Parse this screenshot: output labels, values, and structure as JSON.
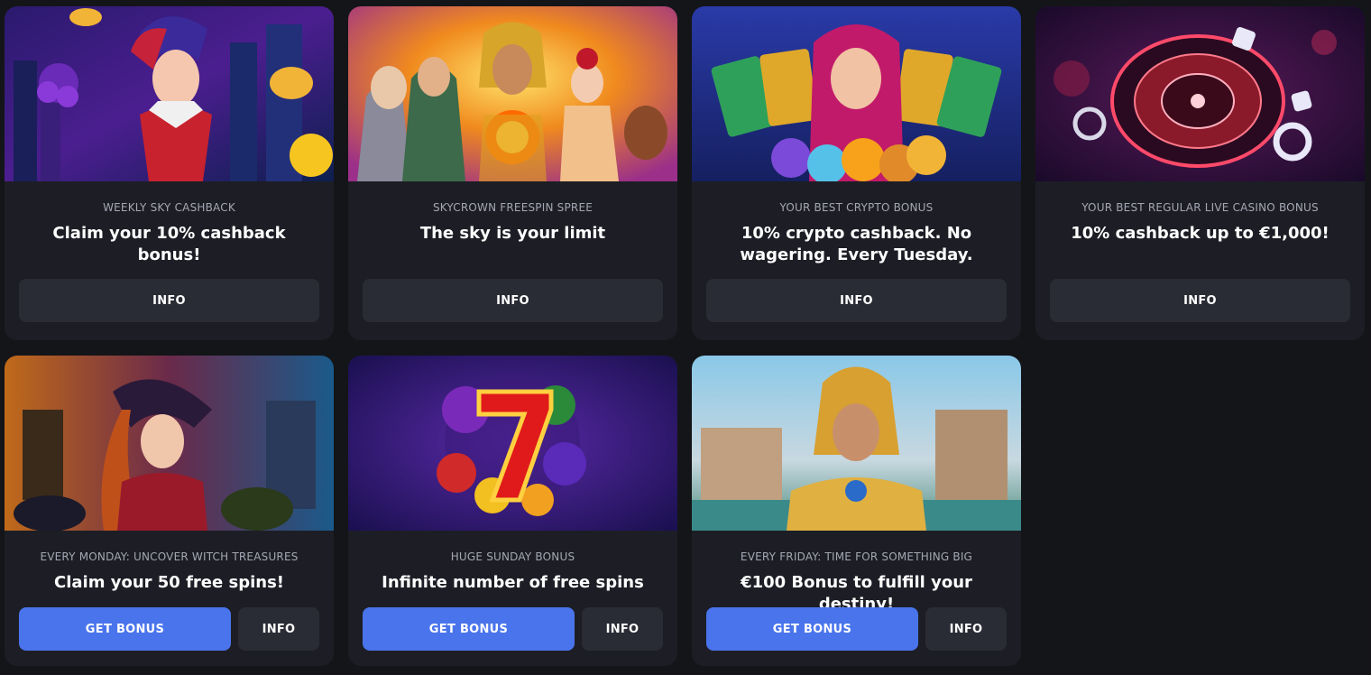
{
  "promotions": [
    {
      "eyebrow": "WEEKLY SKY CASHBACK",
      "headline": "Claim your 10% cashback bonus!",
      "info_label": "INFO",
      "banner_icon": "jester-woman-illustration"
    },
    {
      "eyebrow": "SKYCROWN FREESPIN SPREE",
      "headline": "The sky is your limit",
      "info_label": "INFO",
      "banner_icon": "egyptian-and-asian-characters-illustration"
    },
    {
      "eyebrow": "YOUR BEST CRYPTO BONUS",
      "headline": "10% crypto cashback. No wagering. Every Tuesday.",
      "info_label": "INFO",
      "banner_icon": "fortune-teller-crypto-coins-illustration"
    },
    {
      "eyebrow": "YOUR BEST REGULAR LIVE CASINO BONUS",
      "headline": "10% cashback up to €1,000!",
      "info_label": "INFO",
      "banner_icon": "roulette-wheel-illustration"
    },
    {
      "eyebrow": "EVERY MONDAY: UNCOVER WITCH TREASURES",
      "headline": "Claim your 50 free spins!",
      "get_bonus_label": "GET BONUS",
      "info_label": "INFO",
      "banner_icon": "witch-illustration"
    },
    {
      "eyebrow": "HUGE SUNDAY BONUS",
      "headline": "Infinite number of free spins",
      "get_bonus_label": "GET BONUS",
      "info_label": "INFO",
      "banner_icon": "lucky-seven-fruits-illustration"
    },
    {
      "eyebrow": "EVERY FRIDAY: TIME FOR SOMETHING BIG",
      "headline": "€100 Bonus to fulfill your destiny!",
      "get_bonus_label": "GET BONUS",
      "info_label": "INFO",
      "banner_icon": "egyptian-queen-illustration"
    }
  ],
  "colors": {
    "page_background": "#141519",
    "card_background": "#1d1e25",
    "secondary_button": "#2a2c35",
    "primary_button": "#4a74ec",
    "eyebrow_text": "#a4a7b3"
  }
}
